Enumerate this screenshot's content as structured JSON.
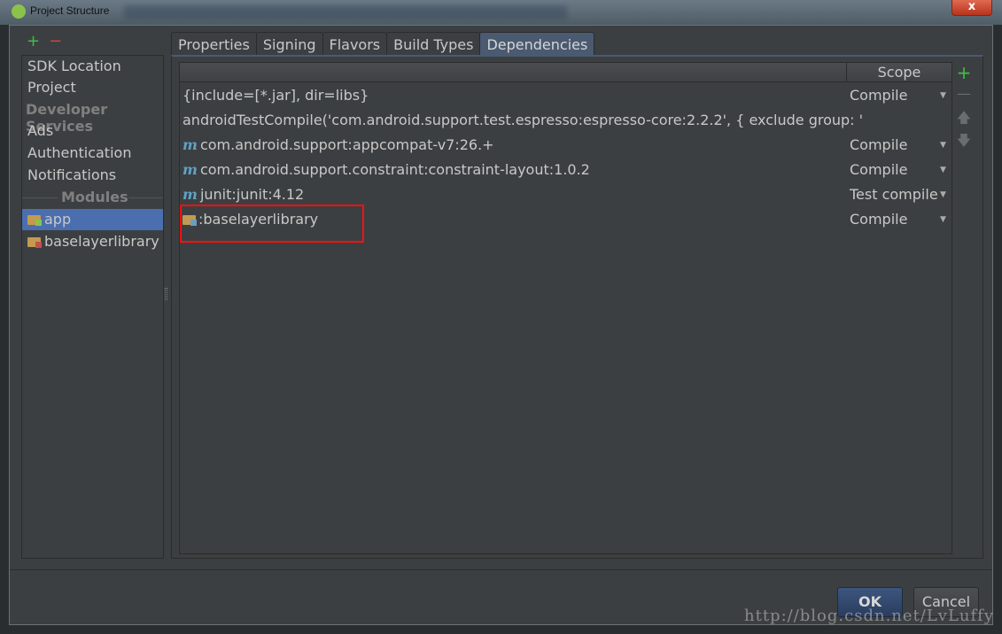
{
  "window": {
    "title": "Project Structure",
    "close": "x"
  },
  "toolbar": {
    "add": "+",
    "remove": "−"
  },
  "sidebar": {
    "items": [
      {
        "label": "SDK Location"
      },
      {
        "label": "Project"
      }
    ],
    "developer_services_header": "Developer Services",
    "services": [
      {
        "label": "Ads"
      },
      {
        "label": "Authentication"
      },
      {
        "label": "Notifications"
      }
    ],
    "modules_header": "Modules",
    "modules": [
      {
        "label": "app",
        "selected": true
      },
      {
        "label": "baselayerlibrary",
        "selected": false
      }
    ]
  },
  "tabs": [
    {
      "label": "Properties"
    },
    {
      "label": "Signing"
    },
    {
      "label": "Flavors"
    },
    {
      "label": "Build Types"
    },
    {
      "label": "Dependencies",
      "active": true
    }
  ],
  "table": {
    "scope_header": "Scope",
    "rows": [
      {
        "name": "{include=[*.jar], dir=libs}",
        "scope": "Compile",
        "icon": "none"
      },
      {
        "name": "androidTestCompile('com.android.support.test.espresso:espresso-core:2.2.2', {        exclude group: '",
        "scope": "",
        "icon": "none"
      },
      {
        "name": "com.android.support:appcompat-v7:26.+",
        "scope": "Compile",
        "icon": "maven-icon"
      },
      {
        "name": "com.android.support.constraint:constraint-layout:1.0.2",
        "scope": "Compile",
        "icon": "maven-icon"
      },
      {
        "name": "junit:junit:4.12",
        "scope": "Test compile",
        "icon": "maven-icon"
      },
      {
        "name": ":baselayerlibrary",
        "scope": "Compile",
        "icon": "module-folder-icon"
      }
    ],
    "maven_glyph": "m"
  },
  "side_buttons": {
    "add": "+",
    "remove": "—",
    "up": "🡅",
    "down": "🡇"
  },
  "buttons": {
    "ok": "OK",
    "cancel": "Cancel"
  },
  "watermark": "http://blog.csdn.net/LvLuffy",
  "colors": {
    "accent": "#4b6eaf",
    "highlight_box": "#ff1010",
    "add": "#3fbf3f",
    "remove": "#d0453a"
  }
}
